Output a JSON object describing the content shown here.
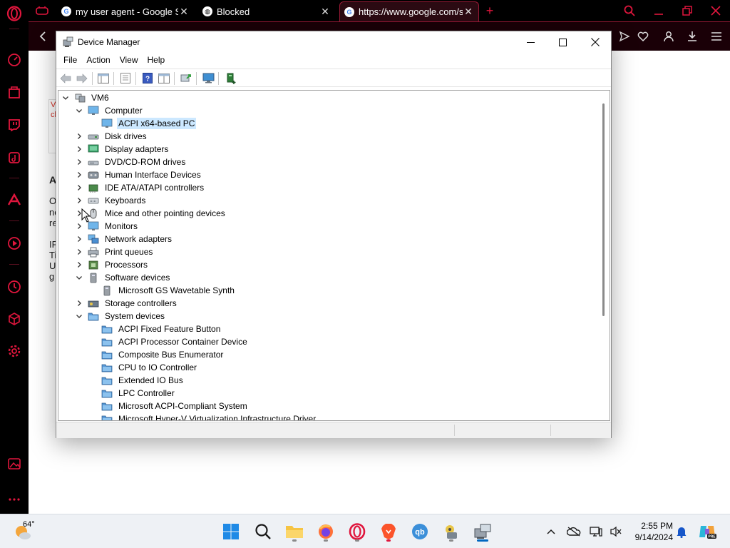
{
  "browser": {
    "tabs": [
      {
        "label": "my user agent - Google Se",
        "close": "✕"
      },
      {
        "label": "Blocked",
        "close": "✕"
      },
      {
        "label": "https://www.google.com/s",
        "close": "✕"
      }
    ],
    "new_tab": "+",
    "page_fragments": [
      "V",
      "cl",
      "A",
      "O",
      "ne",
      "re",
      "IF",
      "Ti",
      "U",
      "g"
    ]
  },
  "device_manager": {
    "title": "Device Manager",
    "menu": [
      "File",
      "Action",
      "View",
      "Help"
    ],
    "tree": [
      {
        "label": "VM6",
        "level": 0,
        "expander": "open",
        "icon": "computer-root"
      },
      {
        "label": "Computer",
        "level": 1,
        "expander": "open",
        "icon": "monitor"
      },
      {
        "label": "ACPI x64-based PC",
        "level": 2,
        "expander": "none",
        "icon": "monitor",
        "selected": true
      },
      {
        "label": "Disk drives",
        "level": 1,
        "expander": "closed",
        "icon": "disk"
      },
      {
        "label": "Display adapters",
        "level": 1,
        "expander": "closed",
        "icon": "display"
      },
      {
        "label": "DVD/CD-ROM drives",
        "level": 1,
        "expander": "closed",
        "icon": "dvd"
      },
      {
        "label": "Human Interface Devices",
        "level": 1,
        "expander": "closed",
        "icon": "hid"
      },
      {
        "label": "IDE ATA/ATAPI controllers",
        "level": 1,
        "expander": "closed",
        "icon": "ide"
      },
      {
        "label": "Keyboards",
        "level": 1,
        "expander": "closed",
        "icon": "keyboard"
      },
      {
        "label": "Mice and other pointing devices",
        "level": 1,
        "expander": "closed",
        "icon": "mouse"
      },
      {
        "label": "Monitors",
        "level": 1,
        "expander": "closed",
        "icon": "monitor"
      },
      {
        "label": "Network adapters",
        "level": 1,
        "expander": "closed",
        "icon": "network"
      },
      {
        "label": "Print queues",
        "level": 1,
        "expander": "closed",
        "icon": "printer"
      },
      {
        "label": "Processors",
        "level": 1,
        "expander": "closed",
        "icon": "cpu"
      },
      {
        "label": "Software devices",
        "level": 1,
        "expander": "open",
        "icon": "software"
      },
      {
        "label": "Microsoft GS Wavetable Synth",
        "level": 2,
        "expander": "none",
        "icon": "software"
      },
      {
        "label": "Storage controllers",
        "level": 1,
        "expander": "closed",
        "icon": "storage"
      },
      {
        "label": "System devices",
        "level": 1,
        "expander": "open",
        "icon": "sysfolder"
      },
      {
        "label": "ACPI Fixed Feature Button",
        "level": 2,
        "expander": "none",
        "icon": "sysfolder"
      },
      {
        "label": "ACPI Processor Container Device",
        "level": 2,
        "expander": "none",
        "icon": "sysfolder"
      },
      {
        "label": "Composite Bus Enumerator",
        "level": 2,
        "expander": "none",
        "icon": "sysfolder"
      },
      {
        "label": "CPU to IO Controller",
        "level": 2,
        "expander": "none",
        "icon": "sysfolder"
      },
      {
        "label": "Extended IO Bus",
        "level": 2,
        "expander": "none",
        "icon": "sysfolder"
      },
      {
        "label": "LPC Controller",
        "level": 2,
        "expander": "none",
        "icon": "sysfolder"
      },
      {
        "label": "Microsoft ACPI-Compliant System",
        "level": 2,
        "expander": "none",
        "icon": "sysfolder"
      },
      {
        "label": "Microsoft Hyper-V Virtualization Infrastructure Driver",
        "level": 2,
        "expander": "none",
        "icon": "sysfolder"
      }
    ]
  },
  "taskbar": {
    "weather_temp": "64°",
    "time": "2:55 PM",
    "date": "9/14/2024",
    "apps": [
      "start-icon",
      "search-icon",
      "file-explorer-icon",
      "firefox-icon",
      "opera-icon",
      "brave-icon",
      "qbittorrent-icon",
      "app-icon",
      "device-manager-icon"
    ]
  },
  "colors": {
    "opera_accent": "#e0163d",
    "selection": "#cce8ff",
    "taskbar_bg": "#eef1f5"
  }
}
